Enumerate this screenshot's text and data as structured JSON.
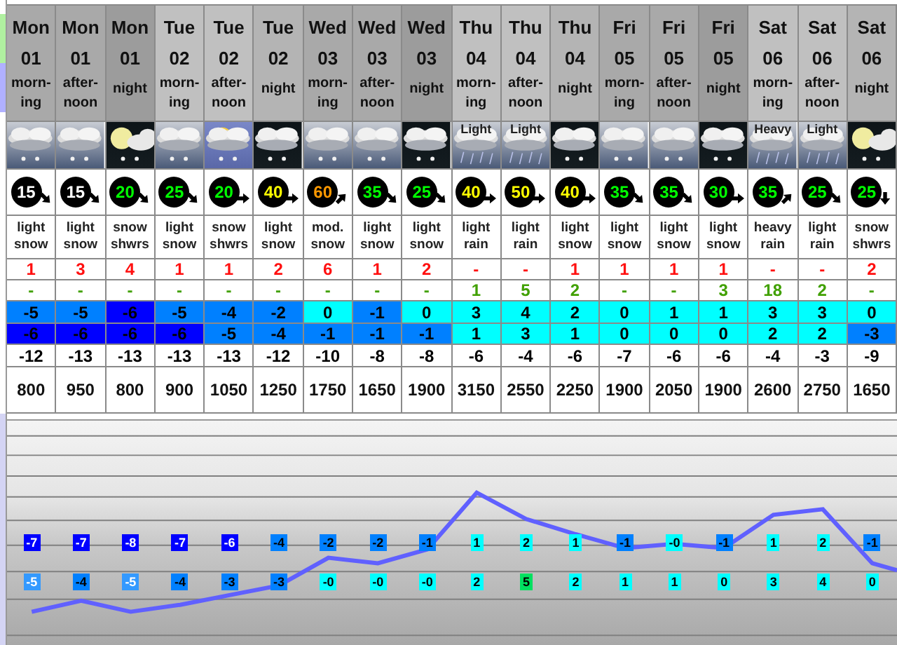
{
  "columns": [
    {
      "day": "Mon",
      "date": "01",
      "period": [
        "morn-",
        "ing"
      ],
      "kind": "day",
      "weather": {
        "kind": "snow"
      },
      "wind": {
        "speed": "15",
        "color": "#ffffff",
        "kind": "southeast"
      },
      "summary": "light snow",
      "snow": "1",
      "rain": "-",
      "temp_max": {
        "value": "-5",
        "color": "#0080ff"
      },
      "temp_min": {
        "value": "-6",
        "color": "#0000ff"
      },
      "chill": "-12",
      "freezing_level": "800",
      "chart_upper": {
        "value": "-7",
        "color": "#0000ff"
      },
      "chart_lower": {
        "value": "-5",
        "color": "#3399ff"
      }
    },
    {
      "day": "Mon",
      "date": "01",
      "period": [
        "after-",
        "noon"
      ],
      "kind": "day",
      "weather": {
        "kind": "snow"
      },
      "wind": {
        "speed": "15",
        "color": "#ffffff",
        "kind": "southeast"
      },
      "summary": "light snow",
      "snow": "3",
      "rain": "-",
      "temp_max": {
        "value": "-5",
        "color": "#0080ff"
      },
      "temp_min": {
        "value": "-6",
        "color": "#0000ff"
      },
      "chill": "-13",
      "freezing_level": "950",
      "chart_upper": {
        "value": "-7",
        "color": "#0000ff"
      },
      "chart_lower": {
        "value": "-4",
        "color": "#0080ff"
      }
    },
    {
      "day": "Mon",
      "date": "01",
      "period": [
        "night"
      ],
      "kind": "night",
      "weather": {
        "kind": "moon"
      },
      "wind": {
        "speed": "20",
        "color": "#00ff00",
        "kind": "southeast"
      },
      "summary": "snow shwrs",
      "snow": "4",
      "rain": "-",
      "temp_max": {
        "value": "-6",
        "color": "#0000ff"
      },
      "temp_min": {
        "value": "-6",
        "color": "#0000ff"
      },
      "chill": "-13",
      "freezing_level": "800",
      "chart_upper": {
        "value": "-8",
        "color": "#0000ff"
      },
      "chart_lower": {
        "value": "-5",
        "color": "#3399ff"
      }
    },
    {
      "day": "Tue",
      "date": "02",
      "period": [
        "morn-",
        "ing"
      ],
      "kind": "day",
      "weather": {
        "kind": "snow"
      },
      "wind": {
        "speed": "25",
        "color": "#00ff00",
        "kind": "southeast"
      },
      "summary": "light snow",
      "snow": "1",
      "rain": "-",
      "temp_max": {
        "value": "-5",
        "color": "#0080ff"
      },
      "temp_min": {
        "value": "-6",
        "color": "#0000ff"
      },
      "chill": "-13",
      "freezing_level": "900",
      "chart_upper": {
        "value": "-7",
        "color": "#0000ff"
      },
      "chart_lower": {
        "value": "-4",
        "color": "#0080ff"
      }
    },
    {
      "day": "Tue",
      "date": "02",
      "period": [
        "after-",
        "noon"
      ],
      "kind": "day",
      "weather": {
        "kind": "sun"
      },
      "wind": {
        "speed": "20",
        "color": "#00ff00",
        "kind": "east"
      },
      "summary": "snow shwrs",
      "snow": "1",
      "rain": "-",
      "temp_max": {
        "value": "-4",
        "color": "#0080ff"
      },
      "temp_min": {
        "value": "-5",
        "color": "#0080ff"
      },
      "chill": "-13",
      "freezing_level": "1050",
      "chart_upper": {
        "value": "-6",
        "color": "#0000ff"
      },
      "chart_lower": {
        "value": "-3",
        "color": "#0080ff"
      }
    },
    {
      "day": "Tue",
      "date": "02",
      "period": [
        "night"
      ],
      "kind": "night",
      "weather": {
        "kind": "snow"
      },
      "wind": {
        "speed": "40",
        "color": "#ffff00",
        "kind": "east"
      },
      "summary": "light snow",
      "snow": "2",
      "rain": "-",
      "temp_max": {
        "value": "-2",
        "color": "#0080ff"
      },
      "temp_min": {
        "value": "-4",
        "color": "#0080ff"
      },
      "chill": "-12",
      "freezing_level": "1250",
      "chart_upper": {
        "value": "-4",
        "color": "#0080ff"
      },
      "chart_lower": {
        "value": "-3",
        "color": "#0080ff"
      }
    },
    {
      "day": "Wed",
      "date": "03",
      "period": [
        "morn-",
        "ing"
      ],
      "kind": "day",
      "weather": {
        "kind": "snow"
      },
      "wind": {
        "speed": "60",
        "color": "#ff9900",
        "kind": "northeast"
      },
      "summary": "mod. snow",
      "snow": "6",
      "rain": "-",
      "temp_max": {
        "value": "0",
        "color": "#00ffff"
      },
      "temp_min": {
        "value": "-1",
        "color": "#0080ff"
      },
      "chill": "-10",
      "freezing_level": "1750",
      "chart_upper": {
        "value": "-2",
        "color": "#0080ff"
      },
      "chart_lower": {
        "value": "-0",
        "color": "#00ffff"
      }
    },
    {
      "day": "Wed",
      "date": "03",
      "period": [
        "after-",
        "noon"
      ],
      "kind": "day",
      "weather": {
        "kind": "snow"
      },
      "wind": {
        "speed": "35",
        "color": "#00ff00",
        "kind": "southeast"
      },
      "summary": "light snow",
      "snow": "1",
      "rain": "-",
      "temp_max": {
        "value": "-1",
        "color": "#0080ff"
      },
      "temp_min": {
        "value": "-1",
        "color": "#0080ff"
      },
      "chill": "-8",
      "freezing_level": "1650",
      "chart_upper": {
        "value": "-2",
        "color": "#0080ff"
      },
      "chart_lower": {
        "value": "-0",
        "color": "#00ffff"
      }
    },
    {
      "day": "Wed",
      "date": "03",
      "period": [
        "night"
      ],
      "kind": "night",
      "weather": {
        "kind": "snow"
      },
      "wind": {
        "speed": "25",
        "color": "#00ff00",
        "kind": "southeast"
      },
      "summary": "light snow",
      "snow": "2",
      "rain": "-",
      "temp_max": {
        "value": "0",
        "color": "#00ffff"
      },
      "temp_min": {
        "value": "-1",
        "color": "#0080ff"
      },
      "chill": "-8",
      "freezing_level": "1900",
      "chart_upper": {
        "value": "-1",
        "color": "#0080ff"
      },
      "chart_lower": {
        "value": "-0",
        "color": "#00ffff"
      }
    },
    {
      "day": "Thu",
      "date": "04",
      "period": [
        "morn-",
        "ing"
      ],
      "kind": "day",
      "weather": {
        "kind": "rain",
        "label": "Light"
      },
      "wind": {
        "speed": "40",
        "color": "#ffff00",
        "kind": "east"
      },
      "summary": "light rain",
      "snow": "-",
      "rain": "1",
      "temp_max": {
        "value": "3",
        "color": "#00ffff"
      },
      "temp_min": {
        "value": "1",
        "color": "#00ffff"
      },
      "chill": "-6",
      "freezing_level": "3150",
      "chart_upper": {
        "value": "1",
        "color": "#00ffff"
      },
      "chart_lower": {
        "value": "2",
        "color": "#00ffff"
      }
    },
    {
      "day": "Thu",
      "date": "04",
      "period": [
        "after-",
        "noon"
      ],
      "kind": "day",
      "weather": {
        "kind": "rain",
        "label": "Light"
      },
      "wind": {
        "speed": "50",
        "color": "#ffff00",
        "kind": "east"
      },
      "summary": "light rain",
      "snow": "-",
      "rain": "5",
      "temp_max": {
        "value": "4",
        "color": "#00ffff"
      },
      "temp_min": {
        "value": "3",
        "color": "#00ffff"
      },
      "chill": "-4",
      "freezing_level": "2550",
      "chart_upper": {
        "value": "2",
        "color": "#00ffff"
      },
      "chart_lower": {
        "value": "5",
        "color": "#00e060"
      }
    },
    {
      "day": "Thu",
      "date": "04",
      "period": [
        "night"
      ],
      "kind": "night",
      "weather": {
        "kind": "snow"
      },
      "wind": {
        "speed": "40",
        "color": "#ffff00",
        "kind": "east"
      },
      "summary": "light snow",
      "snow": "1",
      "rain": "2",
      "temp_max": {
        "value": "2",
        "color": "#00ffff"
      },
      "temp_min": {
        "value": "1",
        "color": "#00ffff"
      },
      "chill": "-6",
      "freezing_level": "2250",
      "chart_upper": {
        "value": "1",
        "color": "#00ffff"
      },
      "chart_lower": {
        "value": "2",
        "color": "#00ffff"
      }
    },
    {
      "day": "Fri",
      "date": "05",
      "period": [
        "morn-",
        "ing"
      ],
      "kind": "day",
      "weather": {
        "kind": "snow"
      },
      "wind": {
        "speed": "35",
        "color": "#00ff00",
        "kind": "southeast"
      },
      "summary": "light snow",
      "snow": "1",
      "rain": "-",
      "temp_max": {
        "value": "0",
        "color": "#00ffff"
      },
      "temp_min": {
        "value": "0",
        "color": "#00ffff"
      },
      "chill": "-7",
      "freezing_level": "1900",
      "chart_upper": {
        "value": "-1",
        "color": "#0080ff"
      },
      "chart_lower": {
        "value": "1",
        "color": "#00ffff"
      }
    },
    {
      "day": "Fri",
      "date": "05",
      "period": [
        "after-",
        "noon"
      ],
      "kind": "day",
      "weather": {
        "kind": "snow"
      },
      "wind": {
        "speed": "35",
        "color": "#00ff00",
        "kind": "southeast"
      },
      "summary": "light snow",
      "snow": "1",
      "rain": "-",
      "temp_max": {
        "value": "1",
        "color": "#00ffff"
      },
      "temp_min": {
        "value": "0",
        "color": "#00ffff"
      },
      "chill": "-6",
      "freezing_level": "2050",
      "chart_upper": {
        "value": "-0",
        "color": "#00ffff"
      },
      "chart_lower": {
        "value": "1",
        "color": "#00ffff"
      }
    },
    {
      "day": "Fri",
      "date": "05",
      "period": [
        "night"
      ],
      "kind": "night",
      "weather": {
        "kind": "snow"
      },
      "wind": {
        "speed": "30",
        "color": "#00ff00",
        "kind": "east"
      },
      "summary": "light snow",
      "snow": "1",
      "rain": "3",
      "temp_max": {
        "value": "1",
        "color": "#00ffff"
      },
      "temp_min": {
        "value": "0",
        "color": "#00ffff"
      },
      "chill": "-6",
      "freezing_level": "1900",
      "chart_upper": {
        "value": "-1",
        "color": "#0080ff"
      },
      "chart_lower": {
        "value": "0",
        "color": "#00ffff"
      }
    },
    {
      "day": "Sat",
      "date": "06",
      "period": [
        "morn-",
        "ing"
      ],
      "kind": "day",
      "weather": {
        "kind": "rain",
        "label": "Heavy"
      },
      "wind": {
        "speed": "35",
        "color": "#00ff00",
        "kind": "northeast"
      },
      "summary": "heavy rain",
      "snow": "-",
      "rain": "18",
      "temp_max": {
        "value": "3",
        "color": "#00ffff"
      },
      "temp_min": {
        "value": "2",
        "color": "#00ffff"
      },
      "chill": "-4",
      "freezing_level": "2600",
      "chart_upper": {
        "value": "1",
        "color": "#00ffff"
      },
      "chart_lower": {
        "value": "3",
        "color": "#00ffff"
      }
    },
    {
      "day": "Sat",
      "date": "06",
      "period": [
        "after-",
        "noon"
      ],
      "kind": "day",
      "weather": {
        "kind": "rain",
        "label": "Light"
      },
      "wind": {
        "speed": "25",
        "color": "#00ff00",
        "kind": "southeast"
      },
      "summary": "light rain",
      "snow": "-",
      "rain": "2",
      "temp_max": {
        "value": "3",
        "color": "#00ffff"
      },
      "temp_min": {
        "value": "2",
        "color": "#00ffff"
      },
      "chill": "-3",
      "freezing_level": "2750",
      "chart_upper": {
        "value": "2",
        "color": "#00ffff"
      },
      "chart_lower": {
        "value": "4",
        "color": "#00ffff"
      }
    },
    {
      "day": "Sat",
      "date": "06",
      "period": [
        "night"
      ],
      "kind": "night",
      "weather": {
        "kind": "moon"
      },
      "wind": {
        "speed": "25",
        "color": "#00ff00",
        "kind": "south"
      },
      "summary": "snow shwrs",
      "snow": "2",
      "rain": "-",
      "temp_max": {
        "value": "0",
        "color": "#00ffff"
      },
      "temp_min": {
        "value": "-3",
        "color": "#0080ff"
      },
      "chill": "-9",
      "freezing_level": "1650",
      "chart_upper": {
        "value": "-1",
        "color": "#0080ff"
      },
      "chart_lower": {
        "value": "0",
        "color": "#00ffff"
      }
    }
  ]
}
